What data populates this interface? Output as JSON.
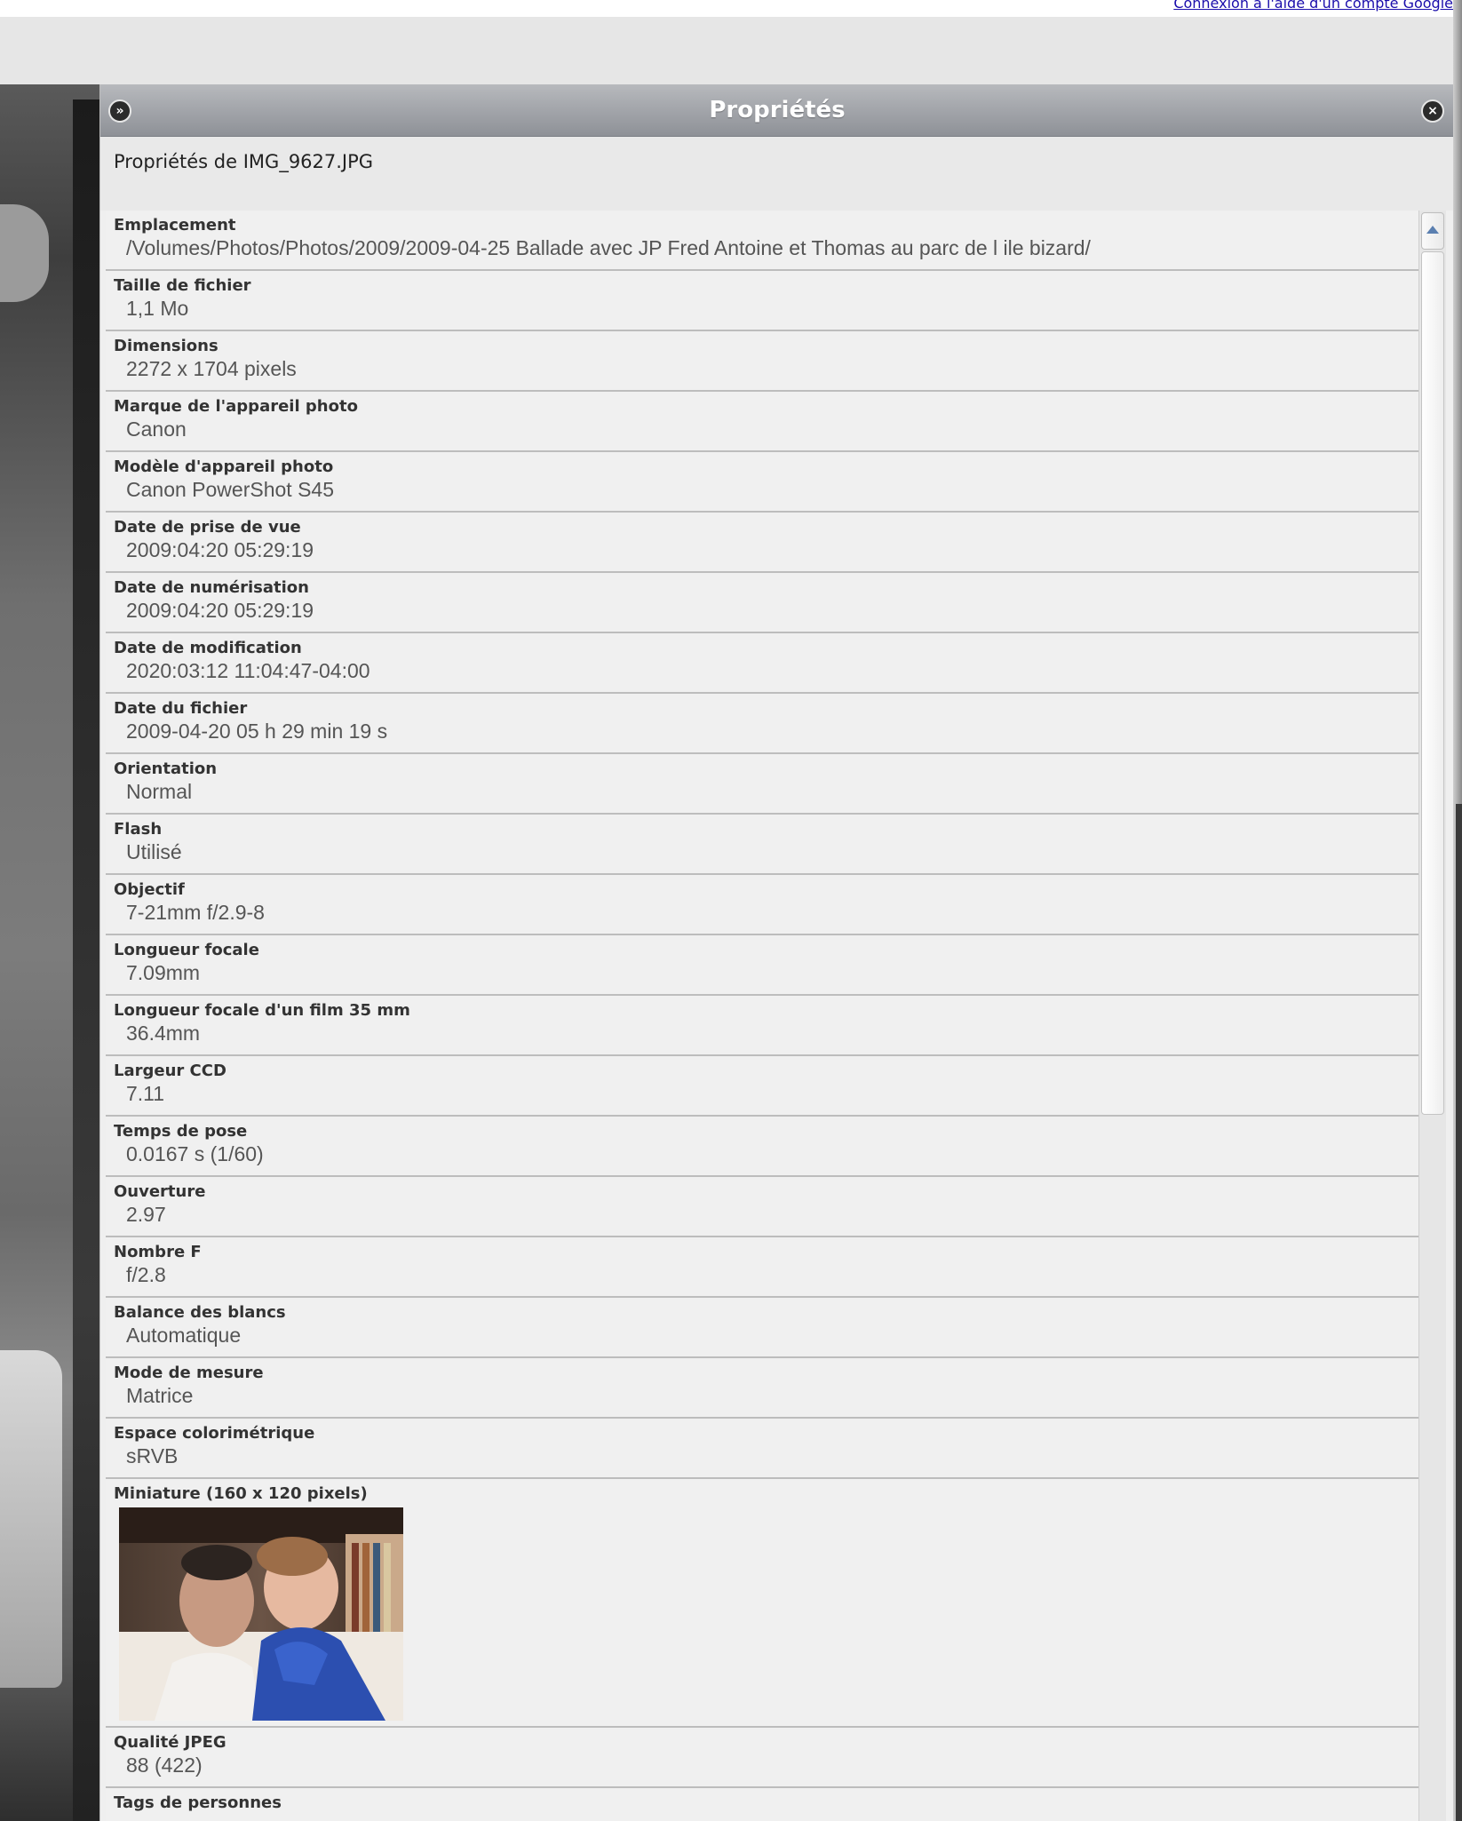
{
  "top_link": "Connexion à l'aide d'un compte Google",
  "panel": {
    "title": "Propriétés",
    "subtitle": "Propriétés de IMG_9627.JPG",
    "collapse_glyph": "»",
    "close_glyph": "×",
    "collapse_icon": "double-chevron-right-icon",
    "close_icon": "close-circle-icon"
  },
  "properties": [
    {
      "label": "Emplacement",
      "value": "/Volumes/Photos/Photos/2009/2009-04-25 Ballade avec JP Fred Antoine et Thomas au parc de l ile bizard/"
    },
    {
      "label": "Taille de fichier",
      "value": "1,1 Mo"
    },
    {
      "label": "Dimensions",
      "value": "2272 x 1704 pixels"
    },
    {
      "label": "Marque de l'appareil photo",
      "value": "Canon"
    },
    {
      "label": "Modèle d'appareil photo",
      "value": "Canon PowerShot S45"
    },
    {
      "label": "Date de prise de vue",
      "value": "2009:04:20 05:29:19"
    },
    {
      "label": "Date de numérisation",
      "value": "2009:04:20 05:29:19"
    },
    {
      "label": "Date de modification",
      "value": "2020:03:12 11:04:47-04:00"
    },
    {
      "label": "Date du fichier",
      "value": "2009-04-20 05 h 29 min 19 s"
    },
    {
      "label": "Orientation",
      "value": "Normal"
    },
    {
      "label": "Flash",
      "value": "Utilisé"
    },
    {
      "label": "Objectif",
      "value": "7-21mm f/2.9-8"
    },
    {
      "label": "Longueur focale",
      "value": "7.09mm"
    },
    {
      "label": "Longueur focale d'un film 35 mm",
      "value": "36.4mm"
    },
    {
      "label": "Largeur CCD",
      "value": "7.11"
    },
    {
      "label": "Temps de pose",
      "value": "0.0167 s (1/60)"
    },
    {
      "label": "Ouverture",
      "value": "2.97"
    },
    {
      "label": "Nombre F",
      "value": "f/2.8"
    },
    {
      "label": "Balance des blancs",
      "value": "Automatique"
    },
    {
      "label": "Mode de mesure",
      "value": "Matrice"
    },
    {
      "label": "Espace colorimétrique",
      "value": "sRVB"
    }
  ],
  "thumbnail": {
    "label": "Miniature (160 x 120 pixels)"
  },
  "properties_after": [
    {
      "label": "Qualité JPEG",
      "value": "88 (422)"
    },
    {
      "label": "Tags de personnes",
      "value": ""
    }
  ]
}
